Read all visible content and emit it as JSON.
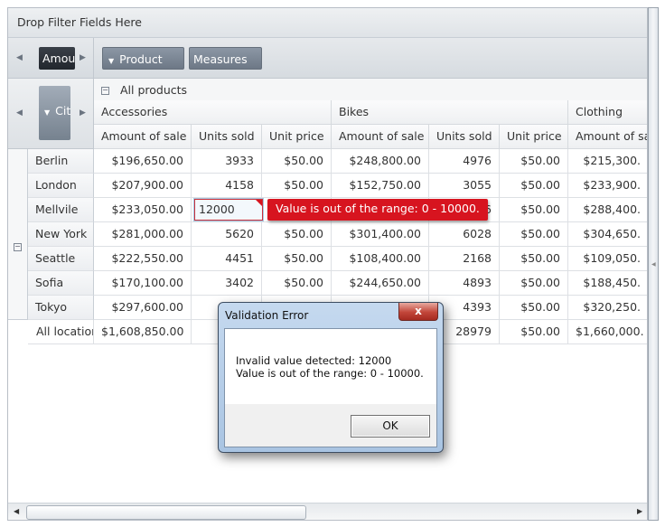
{
  "filter_zone": {
    "label": "Drop Filter Fields Here"
  },
  "data_fields": {
    "chip_label": "Amount of sale",
    "chip_visible": "Amou"
  },
  "column_fields": [
    {
      "label": "Product",
      "has_filter_icon": true
    },
    {
      "label": "Measures",
      "has_filter_icon": false
    }
  ],
  "row_fields": {
    "chip_label": "City",
    "chip_visible": "Cit"
  },
  "icons": {
    "left_arrow": "◀",
    "right_arrow": "▶",
    "filter": "▼",
    "collapse": "−",
    "close": "x"
  },
  "column_header": {
    "root_label": "All products",
    "groups": [
      {
        "label": "Accessories",
        "measures": [
          "Amount of sale",
          "Units sold",
          "Unit price"
        ]
      },
      {
        "label": "Bikes",
        "measures": [
          "Amount of sale",
          "Units sold",
          "Unit price"
        ]
      },
      {
        "label": "Clothing",
        "measures": [
          "Amount of sale"
        ]
      }
    ]
  },
  "rows": [
    {
      "city": "Berlin",
      "values": [
        "$196,650.00",
        "3933",
        "$50.00",
        "$248,800.00",
        "4976",
        "$50.00",
        "$215,300."
      ]
    },
    {
      "city": "London",
      "values": [
        "$207,900.00",
        "4158",
        "$50.00",
        "$152,750.00",
        "3055",
        "$50.00",
        "$233,900."
      ]
    },
    {
      "city": "Mellvile",
      "values": [
        "$233,050.00",
        "12000",
        "",
        "",
        "466",
        "$50.00",
        "$288,400."
      ]
    },
    {
      "city": "New York",
      "values": [
        "$281,000.00",
        "5620",
        "$50.00",
        "$301,400.00",
        "6028",
        "$50.00",
        "$304,650."
      ]
    },
    {
      "city": "Seattle",
      "values": [
        "$222,550.00",
        "4451",
        "$50.00",
        "$108,400.00",
        "2168",
        "$50.00",
        "$109,050."
      ]
    },
    {
      "city": "Sofia",
      "values": [
        "$170,100.00",
        "3402",
        "$50.00",
        "$244,650.00",
        "4893",
        "$50.00",
        "$188,450."
      ]
    },
    {
      "city": "Tokyo",
      "values": [
        "$297,600.00",
        "",
        "",
        "",
        "4393",
        "$50.00",
        "$320,250."
      ]
    }
  ],
  "total_row": {
    "label": "All location",
    "values": [
      "$1,608,850.00",
      "",
      "",
      "",
      "28979",
      "$50.00",
      "$1,660,000."
    ]
  },
  "editor": {
    "value": "12000"
  },
  "validation_tooltip": {
    "text": "Value is out of the range: 0 - 10000.",
    "color": "#d7141f"
  },
  "dialog": {
    "title": "Validation Error",
    "line1": "Invalid value detected: 12000",
    "line2": "Value is out of the range: 0 - 10000.",
    "ok_label": "OK"
  }
}
